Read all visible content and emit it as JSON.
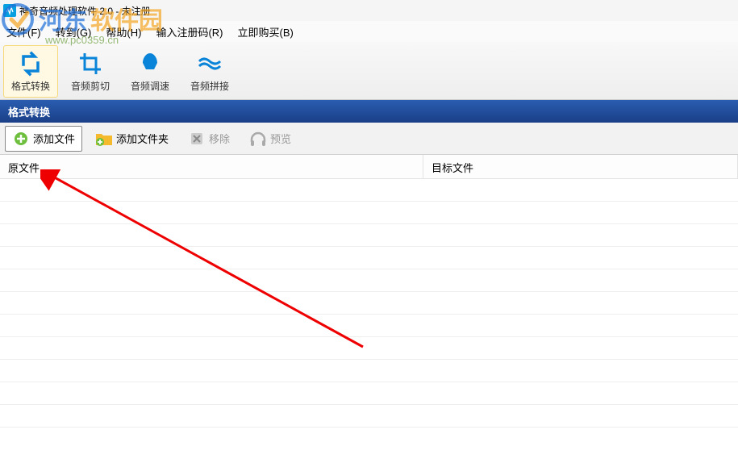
{
  "title": "神奇音频处理软件 2.0 - 未注册",
  "watermark": {
    "text": "河东软件园",
    "url": "www.pc0359.cn"
  },
  "menu": {
    "file": "文件(F)",
    "goto": "转到(G)",
    "help": "帮助(H)",
    "register": "输入注册码(R)",
    "buy": "立即购买(B)"
  },
  "toolbar": {
    "convert": "格式转换",
    "trim": "音频剪切",
    "speed": "音频调速",
    "concat": "音频拼接"
  },
  "section": {
    "title": "格式转换"
  },
  "actions": {
    "addFile": "添加文件",
    "addFolder": "添加文件夹",
    "remove": "移除",
    "preview": "预览"
  },
  "columns": {
    "source": "原文件",
    "target": "目标文件"
  }
}
